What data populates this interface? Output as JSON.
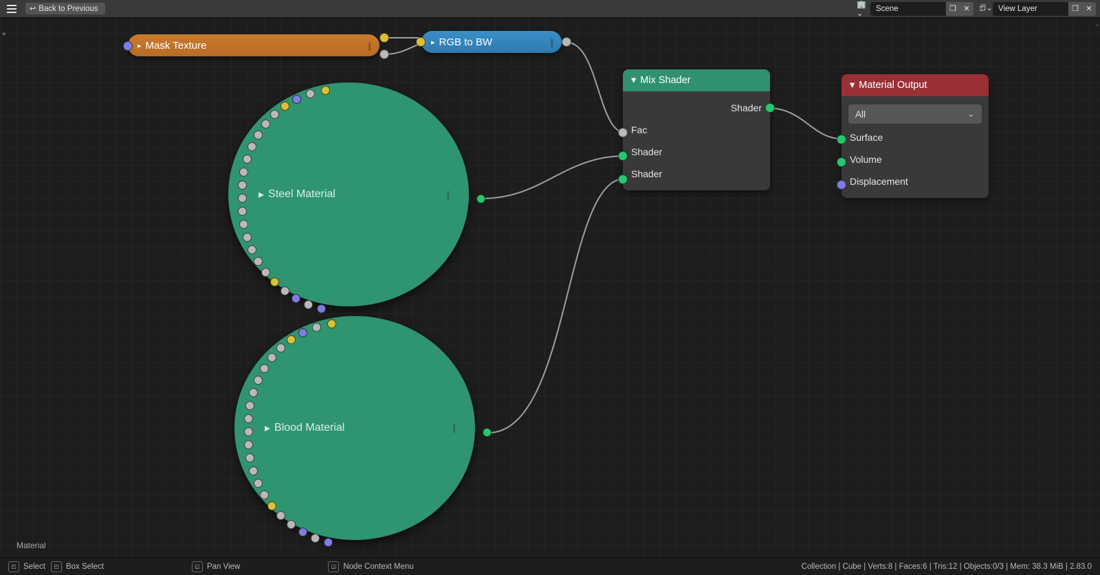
{
  "header": {
    "back": "Back to Previous",
    "scene": "Scene",
    "layer": "View Layer"
  },
  "breadcrumb": "Material",
  "nodes": {
    "mask": {
      "title": "Mask Texture"
    },
    "rgbbw": {
      "title": "RGB to BW"
    },
    "steel": {
      "title": "Steel Material"
    },
    "blood": {
      "title": "Blood Material"
    },
    "mix": {
      "title": "Mix Shader",
      "out": "Shader",
      "in": [
        "Fac",
        "Shader",
        "Shader"
      ]
    },
    "output": {
      "title": "Material Output",
      "target": "All",
      "in": [
        "Surface",
        "Volume",
        "Displacement"
      ]
    }
  },
  "footer": {
    "hints": [
      "Select",
      "Box Select",
      "Pan View",
      "Node Context Menu"
    ],
    "status": "Collection | Cube | Verts:8 | Faces:6 | Tris:12 | Objects:0/3 | Mem: 38.3 MiB | 2.83.0"
  }
}
